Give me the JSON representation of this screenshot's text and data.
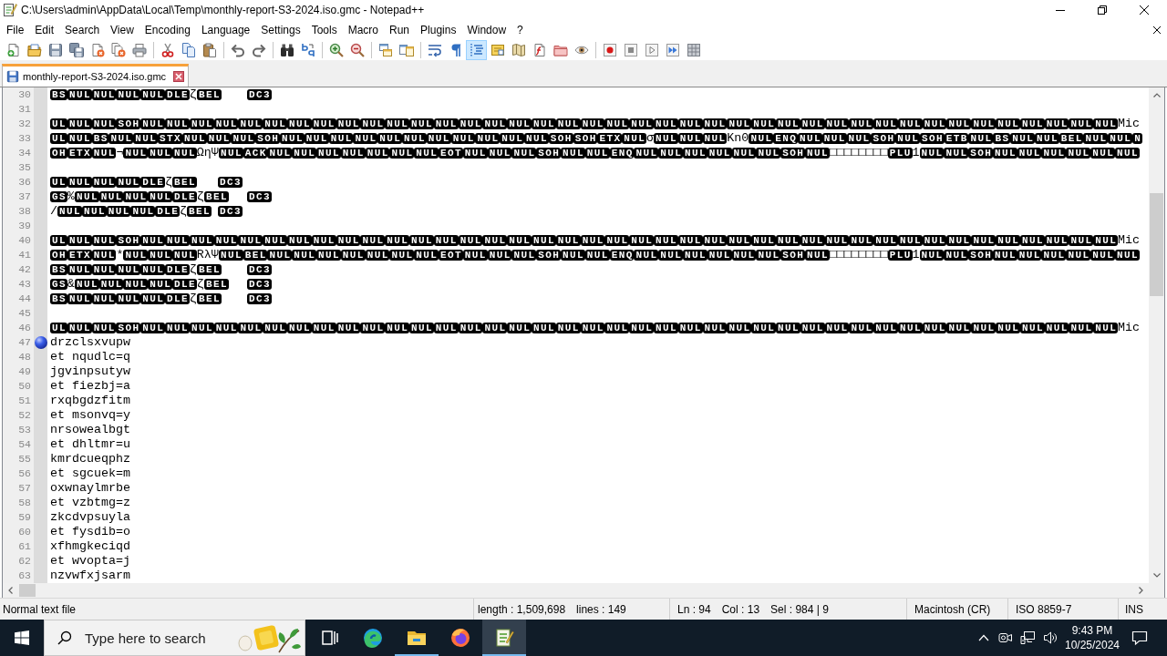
{
  "window": {
    "title": "C:\\Users\\admin\\AppData\\Local\\Temp\\monthly-report-S3-2024.iso.gmc - Notepad++"
  },
  "menu": [
    "File",
    "Edit",
    "Search",
    "View",
    "Encoding",
    "Language",
    "Settings",
    "Tools",
    "Macro",
    "Run",
    "Plugins",
    "Window",
    "?"
  ],
  "toolbar": [
    {
      "buttons": [
        {
          "pressed": false
        },
        {
          "pressed": false
        },
        {
          "pressed": false
        },
        {
          "pressed": false
        },
        {
          "pressed": false
        },
        {
          "pressed": false
        },
        {
          "pressed": false
        }
      ]
    },
    {
      "buttons": [
        {
          "pressed": false
        },
        {
          "pressed": false
        },
        {
          "pressed": false
        }
      ]
    },
    {
      "buttons": [
        {
          "pressed": false
        },
        {
          "pressed": false
        }
      ]
    },
    {
      "buttons": [
        {
          "pressed": false
        },
        {
          "pressed": false
        }
      ]
    },
    {
      "buttons": [
        {
          "pressed": false
        },
        {
          "pressed": false
        }
      ]
    },
    {
      "buttons": [
        {
          "pressed": false
        },
        {
          "pressed": false
        }
      ]
    },
    {
      "buttons": [
        {
          "pressed": false
        },
        {
          "pressed": false
        },
        {
          "pressed": true
        },
        {
          "pressed": false
        },
        {
          "pressed": false
        },
        {
          "pressed": false
        },
        {
          "pressed": false
        },
        {
          "pressed": false
        }
      ]
    },
    {
      "buttons": [
        {
          "pressed": false
        },
        {
          "pressed": false
        },
        {
          "pressed": false
        },
        {
          "pressed": false
        },
        {
          "pressed": false
        }
      ]
    }
  ],
  "tabs": [
    {
      "label": "monthly-report-S3-2024.iso.gmc",
      "selected": true
    }
  ],
  "editor": {
    "lines": [
      {
        "number": "30",
        "bookmarked": false,
        "tokens": [
          {
            "ctrl": "BS"
          },
          {
            "ctrl": "NUL"
          },
          {
            "ctrl": "NUL"
          },
          {
            "ctrl": "NUL"
          },
          {
            "ctrl": "NUL"
          },
          {
            "ctrl": "DLE"
          },
          {
            "text": "ζ"
          },
          {
            "ctrl": "BEL"
          },
          {
            "tab": true
          },
          {
            "ctrl": "DC3"
          }
        ]
      },
      {
        "number": "31",
        "bookmarked": false
      },
      {
        "number": "32",
        "bookmarked": false,
        "tokens": [
          {
            "ctrl": "UL"
          },
          {
            "ctrl": "NUL"
          },
          {
            "ctrl": "NUL"
          },
          {
            "ctrl": "SOH"
          },
          {
            "ctrl": "NUL"
          },
          {
            "ctrl": "NUL"
          },
          {
            "ctrl": "NUL"
          },
          {
            "ctrl": "NUL"
          },
          {
            "ctrl": "NUL"
          },
          {
            "ctrl": "NUL"
          },
          {
            "ctrl": "NUL"
          },
          {
            "ctrl": "NUL"
          },
          {
            "ctrl": "NUL"
          },
          {
            "ctrl": "NUL"
          },
          {
            "ctrl": "NUL"
          },
          {
            "ctrl": "NUL"
          },
          {
            "ctrl": "NUL"
          },
          {
            "ctrl": "NUL"
          },
          {
            "ctrl": "NUL"
          },
          {
            "ctrl": "NUL"
          },
          {
            "ctrl": "NUL"
          },
          {
            "ctrl": "NUL"
          },
          {
            "ctrl": "NUL"
          },
          {
            "ctrl": "NUL"
          },
          {
            "ctrl": "NUL"
          },
          {
            "ctrl": "NUL"
          },
          {
            "ctrl": "NUL"
          },
          {
            "ctrl": "NUL"
          },
          {
            "ctrl": "NUL"
          },
          {
            "ctrl": "NUL"
          },
          {
            "ctrl": "NUL"
          },
          {
            "ctrl": "NUL"
          },
          {
            "ctrl": "NUL"
          },
          {
            "ctrl": "NUL"
          },
          {
            "ctrl": "NUL"
          },
          {
            "ctrl": "NUL"
          },
          {
            "ctrl": "NUL"
          },
          {
            "ctrl": "NUL"
          },
          {
            "ctrl": "NUL"
          },
          {
            "ctrl": "NUL"
          },
          {
            "ctrl": "NUL"
          },
          {
            "ctrl": "NUL"
          },
          {
            "ctrl": "NUL"
          },
          {
            "ctrl": "NUL"
          },
          {
            "text": "Mic"
          }
        ]
      },
      {
        "number": "33",
        "bookmarked": false,
        "tokens": [
          {
            "ctrl": "UL"
          },
          {
            "ctrl": "NUL"
          },
          {
            "ctrl": "BS"
          },
          {
            "ctrl": "NUL"
          },
          {
            "ctrl": "NUL"
          },
          {
            "ctrl": "STX"
          },
          {
            "ctrl": "NUL"
          },
          {
            "ctrl": "NUL"
          },
          {
            "ctrl": "NUL"
          },
          {
            "ctrl": "SOH"
          },
          {
            "ctrl": "NUL"
          },
          {
            "ctrl": "NUL"
          },
          {
            "ctrl": "NUL"
          },
          {
            "ctrl": "NUL"
          },
          {
            "ctrl": "NUL"
          },
          {
            "ctrl": "NUL"
          },
          {
            "ctrl": "NUL"
          },
          {
            "ctrl": "NUL"
          },
          {
            "ctrl": "NUL"
          },
          {
            "ctrl": "NUL"
          },
          {
            "ctrl": "NUL"
          },
          {
            "ctrl": "SOH"
          },
          {
            "ctrl": "SOH"
          },
          {
            "ctrl": "ETX"
          },
          {
            "ctrl": "NUL"
          },
          {
            "text": "σ"
          },
          {
            "ctrl": "NUL"
          },
          {
            "ctrl": "NUL"
          },
          {
            "ctrl": "NUL"
          },
          {
            "text": "Kn0"
          },
          {
            "ctrl": "NUL"
          },
          {
            "ctrl": "ENQ"
          },
          {
            "ctrl": "NUL"
          },
          {
            "ctrl": "NUL"
          },
          {
            "ctrl": "NUL"
          },
          {
            "ctrl": "SOH"
          },
          {
            "ctrl": "NUL"
          },
          {
            "ctrl": "SOH"
          },
          {
            "ctrl": "ETB"
          },
          {
            "ctrl": "NUL"
          },
          {
            "ctrl": "BS"
          },
          {
            "ctrl": "NUL"
          },
          {
            "ctrl": "NUL"
          },
          {
            "ctrl": "BEL"
          },
          {
            "ctrl": "NUL"
          },
          {
            "ctrl": "NUL"
          },
          {
            "ctrl": "N"
          }
        ]
      },
      {
        "number": "34",
        "bookmarked": false,
        "tokens": [
          {
            "ctrl": "OH"
          },
          {
            "ctrl": "ETX"
          },
          {
            "ctrl": "NUL"
          },
          {
            "text": "¬"
          },
          {
            "ctrl": "NUL"
          },
          {
            "ctrl": "NUL"
          },
          {
            "ctrl": "NUL"
          },
          {
            "text": "ΩηΨ"
          },
          {
            "ctrl": "NUL"
          },
          {
            "ctrl": "ACK"
          },
          {
            "ctrl": "NUL"
          },
          {
            "ctrl": "NUL"
          },
          {
            "ctrl": "NUL"
          },
          {
            "ctrl": "NUL"
          },
          {
            "ctrl": "NUL"
          },
          {
            "ctrl": "NUL"
          },
          {
            "ctrl": "NUL"
          },
          {
            "ctrl": "EOT"
          },
          {
            "ctrl": "NUL"
          },
          {
            "ctrl": "NUL"
          },
          {
            "ctrl": "NUL"
          },
          {
            "ctrl": "SOH"
          },
          {
            "ctrl": "NUL"
          },
          {
            "ctrl": "NUL"
          },
          {
            "ctrl": "ENQ"
          },
          {
            "ctrl": "NUL"
          },
          {
            "ctrl": "NUL"
          },
          {
            "ctrl": "NUL"
          },
          {
            "ctrl": "NUL"
          },
          {
            "ctrl": "NUL"
          },
          {
            "ctrl": "NUL"
          },
          {
            "ctrl": "SOH"
          },
          {
            "ctrl": "NUL"
          },
          {
            "text": "□□□□□□□□"
          },
          {
            "ctrl": "PLU"
          },
          {
            "text": "1"
          },
          {
            "ctrl": "NUL"
          },
          {
            "ctrl": "NUL"
          },
          {
            "ctrl": "SOH"
          },
          {
            "ctrl": "NUL"
          },
          {
            "ctrl": "NUL"
          },
          {
            "ctrl": "NUL"
          },
          {
            "ctrl": "NUL"
          },
          {
            "ctrl": "NUL"
          },
          {
            "ctrl": "NUL"
          }
        ]
      },
      {
        "number": "35",
        "bookmarked": false
      },
      {
        "number": "36",
        "bookmarked": false,
        "tokens": [
          {
            "ctrl": "UL"
          },
          {
            "ctrl": "NUL"
          },
          {
            "ctrl": "NUL"
          },
          {
            "ctrl": "NUL"
          },
          {
            "ctrl": "DLE"
          },
          {
            "text": "ζ"
          },
          {
            "ctrl": "BEL"
          },
          {
            "tab": true
          },
          {
            "ctrl": "DC3"
          }
        ]
      },
      {
        "number": "37",
        "bookmarked": false,
        "tokens": [
          {
            "ctrl": "GS"
          },
          {
            "text": "%"
          },
          {
            "ctrl": "NUL"
          },
          {
            "ctrl": "NUL"
          },
          {
            "ctrl": "NUL"
          },
          {
            "ctrl": "NUL"
          },
          {
            "ctrl": "DLE"
          },
          {
            "text": "ζ"
          },
          {
            "ctrl": "BEL"
          },
          {
            "tab": true
          },
          {
            "ctrl": "DC3"
          }
        ]
      },
      {
        "number": "38",
        "bookmarked": false,
        "tokens": [
          {
            "text": "/"
          },
          {
            "ctrl": "NUL"
          },
          {
            "ctrl": "NUL"
          },
          {
            "ctrl": "NUL"
          },
          {
            "ctrl": "NUL"
          },
          {
            "ctrl": "DLE"
          },
          {
            "text": "ζ"
          },
          {
            "ctrl": "BEL"
          },
          {
            "tab": true
          },
          {
            "ctrl": "DC3"
          }
        ]
      },
      {
        "number": "39",
        "bookmarked": false
      },
      {
        "number": "40",
        "bookmarked": false,
        "tokens": [
          {
            "ctrl": "UL"
          },
          {
            "ctrl": "NUL"
          },
          {
            "ctrl": "NUL"
          },
          {
            "ctrl": "SOH"
          },
          {
            "ctrl": "NUL"
          },
          {
            "ctrl": "NUL"
          },
          {
            "ctrl": "NUL"
          },
          {
            "ctrl": "NUL"
          },
          {
            "ctrl": "NUL"
          },
          {
            "ctrl": "NUL"
          },
          {
            "ctrl": "NUL"
          },
          {
            "ctrl": "NUL"
          },
          {
            "ctrl": "NUL"
          },
          {
            "ctrl": "NUL"
          },
          {
            "ctrl": "NUL"
          },
          {
            "ctrl": "NUL"
          },
          {
            "ctrl": "NUL"
          },
          {
            "ctrl": "NUL"
          },
          {
            "ctrl": "NUL"
          },
          {
            "ctrl": "NUL"
          },
          {
            "ctrl": "NUL"
          },
          {
            "ctrl": "NUL"
          },
          {
            "ctrl": "NUL"
          },
          {
            "ctrl": "NUL"
          },
          {
            "ctrl": "NUL"
          },
          {
            "ctrl": "NUL"
          },
          {
            "ctrl": "NUL"
          },
          {
            "ctrl": "NUL"
          },
          {
            "ctrl": "NUL"
          },
          {
            "ctrl": "NUL"
          },
          {
            "ctrl": "NUL"
          },
          {
            "ctrl": "NUL"
          },
          {
            "ctrl": "NUL"
          },
          {
            "ctrl": "NUL"
          },
          {
            "ctrl": "NUL"
          },
          {
            "ctrl": "NUL"
          },
          {
            "ctrl": "NUL"
          },
          {
            "ctrl": "NUL"
          },
          {
            "ctrl": "NUL"
          },
          {
            "ctrl": "NUL"
          },
          {
            "ctrl": "NUL"
          },
          {
            "ctrl": "NUL"
          },
          {
            "ctrl": "NUL"
          },
          {
            "ctrl": "NUL"
          },
          {
            "text": "Mic"
          }
        ]
      },
      {
        "number": "41",
        "bookmarked": false,
        "tokens": [
          {
            "ctrl": "OH"
          },
          {
            "ctrl": "ETX"
          },
          {
            "ctrl": "NUL"
          },
          {
            "text": "*"
          },
          {
            "ctrl": "NUL"
          },
          {
            "ctrl": "NUL"
          },
          {
            "ctrl": "NUL"
          },
          {
            "text": "RλΨ"
          },
          {
            "ctrl": "NUL"
          },
          {
            "ctrl": "BEL"
          },
          {
            "ctrl": "NUL"
          },
          {
            "ctrl": "NUL"
          },
          {
            "ctrl": "NUL"
          },
          {
            "ctrl": "NUL"
          },
          {
            "ctrl": "NUL"
          },
          {
            "ctrl": "NUL"
          },
          {
            "ctrl": "NUL"
          },
          {
            "ctrl": "EOT"
          },
          {
            "ctrl": "NUL"
          },
          {
            "ctrl": "NUL"
          },
          {
            "ctrl": "NUL"
          },
          {
            "ctrl": "SOH"
          },
          {
            "ctrl": "NUL"
          },
          {
            "ctrl": "NUL"
          },
          {
            "ctrl": "ENQ"
          },
          {
            "ctrl": "NUL"
          },
          {
            "ctrl": "NUL"
          },
          {
            "ctrl": "NUL"
          },
          {
            "ctrl": "NUL"
          },
          {
            "ctrl": "NUL"
          },
          {
            "ctrl": "NUL"
          },
          {
            "ctrl": "SOH"
          },
          {
            "ctrl": "NUL"
          },
          {
            "text": "□□□□□□□□"
          },
          {
            "ctrl": "PLU"
          },
          {
            "text": "1"
          },
          {
            "ctrl": "NUL"
          },
          {
            "ctrl": "NUL"
          },
          {
            "ctrl": "SOH"
          },
          {
            "ctrl": "NUL"
          },
          {
            "ctrl": "NUL"
          },
          {
            "ctrl": "NUL"
          },
          {
            "ctrl": "NUL"
          },
          {
            "ctrl": "NUL"
          },
          {
            "ctrl": "NUL"
          }
        ]
      },
      {
        "number": "42",
        "bookmarked": false,
        "tokens": [
          {
            "ctrl": "BS"
          },
          {
            "ctrl": "NUL"
          },
          {
            "ctrl": "NUL"
          },
          {
            "ctrl": "NUL"
          },
          {
            "ctrl": "NUL"
          },
          {
            "ctrl": "DLE"
          },
          {
            "text": "ζ"
          },
          {
            "ctrl": "BEL"
          },
          {
            "tab": true
          },
          {
            "ctrl": "DC3"
          }
        ]
      },
      {
        "number": "43",
        "bookmarked": false,
        "tokens": [
          {
            "ctrl": "GS"
          },
          {
            "text": "&"
          },
          {
            "ctrl": "NUL"
          },
          {
            "ctrl": "NUL"
          },
          {
            "ctrl": "NUL"
          },
          {
            "ctrl": "NUL"
          },
          {
            "ctrl": "DLE"
          },
          {
            "text": "ζ"
          },
          {
            "ctrl": "BEL"
          },
          {
            "tab": true
          },
          {
            "ctrl": "DC3"
          }
        ]
      },
      {
        "number": "44",
        "bookmarked": false,
        "tokens": [
          {
            "ctrl": "BS"
          },
          {
            "ctrl": "NUL"
          },
          {
            "ctrl": "NUL"
          },
          {
            "ctrl": "NUL"
          },
          {
            "ctrl": "NUL"
          },
          {
            "ctrl": "DLE"
          },
          {
            "text": "ζ"
          },
          {
            "ctrl": "BEL"
          },
          {
            "tab": true
          },
          {
            "ctrl": "DC3"
          }
        ]
      },
      {
        "number": "45",
        "bookmarked": false
      },
      {
        "number": "46",
        "bookmarked": false,
        "tokens": [
          {
            "ctrl": "UL"
          },
          {
            "ctrl": "NUL"
          },
          {
            "ctrl": "NUL"
          },
          {
            "ctrl": "SOH"
          },
          {
            "ctrl": "NUL"
          },
          {
            "ctrl": "NUL"
          },
          {
            "ctrl": "NUL"
          },
          {
            "ctrl": "NUL"
          },
          {
            "ctrl": "NUL"
          },
          {
            "ctrl": "NUL"
          },
          {
            "ctrl": "NUL"
          },
          {
            "ctrl": "NUL"
          },
          {
            "ctrl": "NUL"
          },
          {
            "ctrl": "NUL"
          },
          {
            "ctrl": "NUL"
          },
          {
            "ctrl": "NUL"
          },
          {
            "ctrl": "NUL"
          },
          {
            "ctrl": "NUL"
          },
          {
            "ctrl": "NUL"
          },
          {
            "ctrl": "NUL"
          },
          {
            "ctrl": "NUL"
          },
          {
            "ctrl": "NUL"
          },
          {
            "ctrl": "NUL"
          },
          {
            "ctrl": "NUL"
          },
          {
            "ctrl": "NUL"
          },
          {
            "ctrl": "NUL"
          },
          {
            "ctrl": "NUL"
          },
          {
            "ctrl": "NUL"
          },
          {
            "ctrl": "NUL"
          },
          {
            "ctrl": "NUL"
          },
          {
            "ctrl": "NUL"
          },
          {
            "ctrl": "NUL"
          },
          {
            "ctrl": "NUL"
          },
          {
            "ctrl": "NUL"
          },
          {
            "ctrl": "NUL"
          },
          {
            "ctrl": "NUL"
          },
          {
            "ctrl": "NUL"
          },
          {
            "ctrl": "NUL"
          },
          {
            "ctrl": "NUL"
          },
          {
            "ctrl": "NUL"
          },
          {
            "ctrl": "NUL"
          },
          {
            "ctrl": "NUL"
          },
          {
            "ctrl": "NUL"
          },
          {
            "ctrl": "NUL"
          },
          {
            "text": "Mic"
          }
        ]
      },
      {
        "number": "47",
        "bookmarked": true,
        "tokens": [
          {
            "text": "drzclsxvupw"
          }
        ]
      },
      {
        "number": "48",
        "bookmarked": false,
        "tokens": [
          {
            "text": "et nqudlc=q"
          }
        ]
      },
      {
        "number": "49",
        "bookmarked": false,
        "tokens": [
          {
            "text": "jgvinpsutyw"
          }
        ]
      },
      {
        "number": "50",
        "bookmarked": false,
        "tokens": [
          {
            "text": "et fiezbj=a"
          }
        ]
      },
      {
        "number": "51",
        "bookmarked": false,
        "tokens": [
          {
            "text": "rxqbgdzfitm"
          }
        ]
      },
      {
        "number": "52",
        "bookmarked": false,
        "tokens": [
          {
            "text": "et msonvq=y"
          }
        ]
      },
      {
        "number": "53",
        "bookmarked": false,
        "tokens": [
          {
            "text": "nrsowealbgt"
          }
        ]
      },
      {
        "number": "54",
        "bookmarked": false,
        "tokens": [
          {
            "text": "et dhltmr=u"
          }
        ]
      },
      {
        "number": "55",
        "bookmarked": false,
        "tokens": [
          {
            "text": "kmrdcueqphz"
          }
        ]
      },
      {
        "number": "56",
        "bookmarked": false,
        "tokens": [
          {
            "text": "et sgcuek=m"
          }
        ]
      },
      {
        "number": "57",
        "bookmarked": false,
        "tokens": [
          {
            "text": "oxwnaylmrbe"
          }
        ]
      },
      {
        "number": "58",
        "bookmarked": false,
        "tokens": [
          {
            "text": "et vzbtmg=z"
          }
        ]
      },
      {
        "number": "59",
        "bookmarked": false,
        "tokens": [
          {
            "text": "zkcdvpsuyla"
          }
        ]
      },
      {
        "number": "60",
        "bookmarked": false,
        "tokens": [
          {
            "text": "et fysdib=o"
          }
        ]
      },
      {
        "number": "61",
        "bookmarked": false,
        "tokens": [
          {
            "text": "xfhmgkeciqd"
          }
        ]
      },
      {
        "number": "62",
        "bookmarked": false,
        "tokens": [
          {
            "text": "et wvopta=j"
          }
        ]
      },
      {
        "number": "63",
        "bookmarked": false,
        "tokens": [
          {
            "text": "nzvwfxjsarm"
          }
        ]
      }
    ]
  },
  "status_bar": [
    [
      "Normal text file"
    ],
    [
      "length : 1,509,698",
      "lines : 149"
    ],
    [
      "Ln : 94",
      "Col : 13",
      "Sel : 984 | 9"
    ],
    [
      "Macintosh (CR)"
    ],
    [
      "ISO 8859-7"
    ],
    [
      "INS"
    ]
  ],
  "taskbar": {
    "search": {
      "placeholder": "Type here to search"
    },
    "apps": [
      {
        "running": false,
        "active": false
      },
      {
        "running": true,
        "active": false
      },
      {
        "running": false,
        "active": false
      },
      {
        "running": true,
        "active": true
      }
    ],
    "clock": {
      "time": "9:43 PM",
      "date": "10/25/2024"
    }
  }
}
